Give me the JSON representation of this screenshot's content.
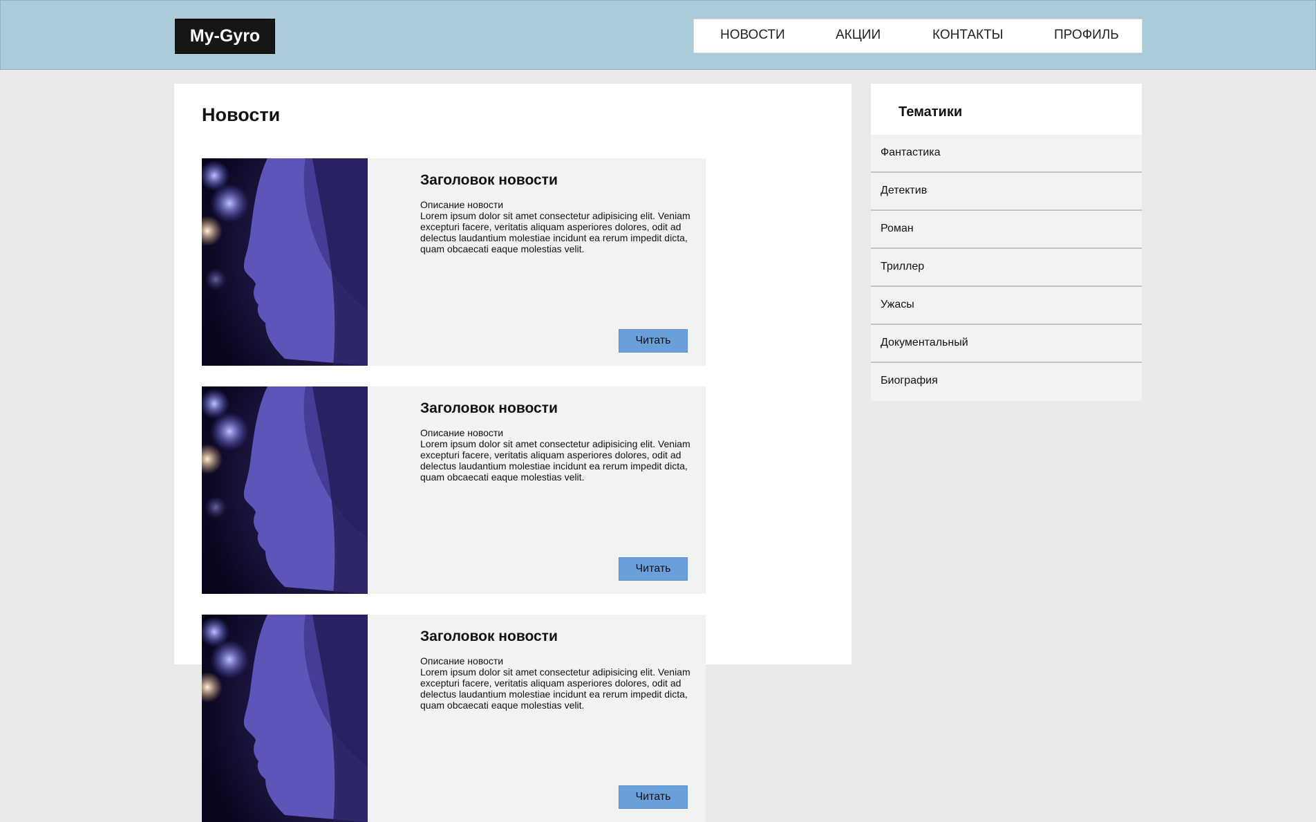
{
  "header": {
    "logo": "My-Gyro",
    "nav": [
      "НОВОСТИ",
      "АКЦИИ",
      "КОНТАКТЫ",
      "ПРОФИЛЬ"
    ]
  },
  "main": {
    "title": "Новости",
    "cards": [
      {
        "title": "Заголовок новости",
        "desc_label": "Описание новости",
        "desc_text": "Lorem ipsum dolor sit amet consectetur adipisicing elit. Veniam excepturi facere, veritatis aliquam asperiores dolores, odit ad delectus laudantium molestiae incidunt ea rerum impedit dicta, quam obcaecati eaque molestias velit.",
        "button": "Читать"
      },
      {
        "title": "Заголовок новости",
        "desc_label": "Описание новости",
        "desc_text": "Lorem ipsum dolor sit amet consectetur adipisicing elit. Veniam excepturi facere, veritatis aliquam asperiores dolores, odit ad delectus laudantium molestiae incidunt ea rerum impedit dicta, quam obcaecati eaque molestias velit.",
        "button": "Читать"
      },
      {
        "title": "Заголовок новости",
        "desc_label": "Описание новости",
        "desc_text": "Lorem ipsum dolor sit amet consectetur adipisicing elit. Veniam excepturi facere, veritatis aliquam asperiores dolores, odit ad delectus laudantium molestiae incidunt ea rerum impedit dicta, quam obcaecati eaque molestias velit.",
        "button": "Читать"
      }
    ]
  },
  "sidebar": {
    "title": "Тематики",
    "items": [
      "Фантастика",
      "Детектив",
      "Роман",
      "Триллер",
      "Ужасы",
      "Документальный",
      "Биография"
    ]
  },
  "colors": {
    "header_bg": "#aacbd8",
    "page_bg": "#e9e9e9",
    "button_bg": "#6a9fdc",
    "card_bg": "#f2f2f2"
  }
}
